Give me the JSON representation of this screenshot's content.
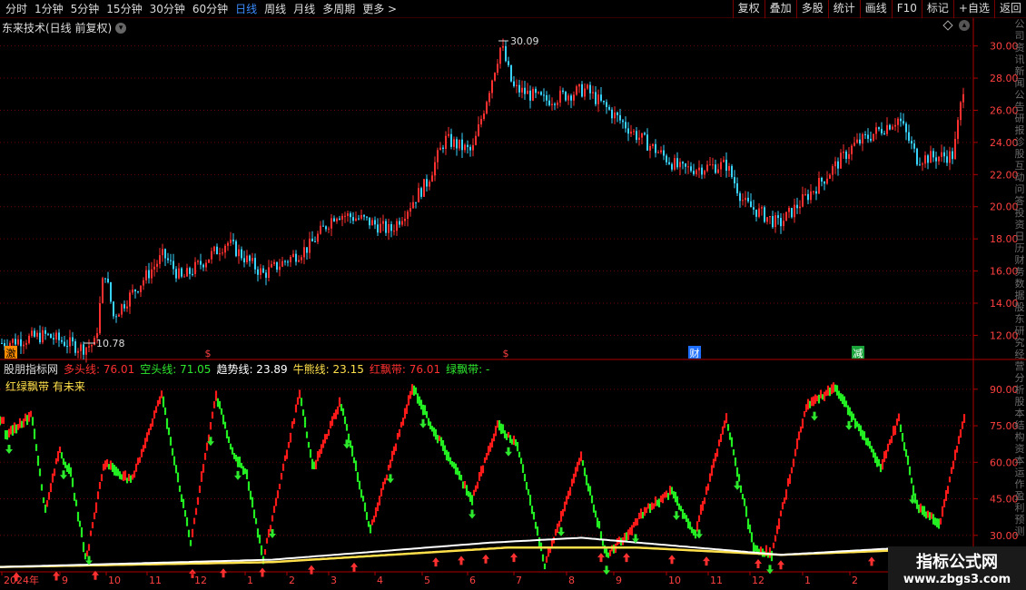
{
  "toolbar": {
    "periods": [
      "分时",
      "1分钟",
      "5分钟",
      "15分钟",
      "30分钟",
      "60分钟",
      "日线",
      "周线",
      "月线",
      "多周期",
      "更多 >"
    ],
    "active_period": "日线",
    "tools": [
      "复权",
      "叠加",
      "多股",
      "统计",
      "画线",
      "F10",
      "标记",
      "+自选",
      "返回"
    ]
  },
  "stock": {
    "title": "东来技术(日线 前复权)"
  },
  "price_chart": {
    "high_label": "30.09",
    "low_label": "10.78",
    "y_ticks": [
      "30.00",
      "28.00",
      "26.00",
      "24.00",
      "22.00",
      "20.00",
      "18.00",
      "16.00",
      "14.00",
      "12.00"
    ],
    "markers": [
      "激",
      "$",
      "$",
      "财",
      "减"
    ]
  },
  "indicator": {
    "name": "股朋指标网",
    "items": [
      {
        "label": "多头线: 76.01",
        "color": "#ff3030"
      },
      {
        "label": "空头线: 71.05",
        "color": "#2ee82e"
      },
      {
        "label": "趋势线: 23.89",
        "color": "#ffffff"
      },
      {
        "label": "牛熊线: 23.15",
        "color": "#ffe04a"
      },
      {
        "label": "红飘带: 76.01",
        "color": "#ff3030"
      },
      {
        "label": "绿飘带: -",
        "color": "#2ee82e"
      }
    ],
    "line2": "红绿飘带 有未来",
    "y_ticks": [
      "90.00",
      "75.00",
      "60.00",
      "45.00",
      "30.00"
    ]
  },
  "x_axis": [
    "2024年",
    "9",
    "10",
    "11",
    "12",
    "1",
    "2",
    "3",
    "4",
    "5",
    "6",
    "7",
    "8",
    "9",
    "10",
    "11",
    "12",
    "1",
    "2"
  ],
  "watermark": {
    "line1": "指标公式网",
    "line2": "www.zbgs3.com"
  },
  "colors": {
    "up": "#ff3030",
    "down": "#39d3ff",
    "ribbon_red": "#ff1a1a",
    "ribbon_green": "#22ee22",
    "trend": "#ffffff",
    "bull": "#ffe04a",
    "grid": "#6a0000"
  },
  "chart_data": {
    "type": "line",
    "ylim": [
      10.5,
      30.6
    ],
    "price_anchors": [
      [
        0,
        11.5
      ],
      [
        50,
        12.0
      ],
      [
        90,
        11.2
      ],
      [
        105,
        11.5
      ],
      [
        115,
        16.2
      ],
      [
        125,
        13.2
      ],
      [
        180,
        17.0
      ],
      [
        200,
        15.5
      ],
      [
        250,
        17.8
      ],
      [
        290,
        15.8
      ],
      [
        340,
        17.5
      ],
      [
        370,
        19.6
      ],
      [
        400,
        19.2
      ],
      [
        430,
        18.5
      ],
      [
        470,
        21.5
      ],
      [
        490,
        24.2
      ],
      [
        520,
        23.4
      ],
      [
        552,
        30.09
      ],
      [
        565,
        27.4
      ],
      [
        600,
        26.6
      ],
      [
        645,
        27.3
      ],
      [
        700,
        24.5
      ],
      [
        750,
        22.3
      ],
      [
        800,
        22.6
      ],
      [
        820,
        20.2
      ],
      [
        858,
        18.9
      ],
      [
        905,
        21.6
      ],
      [
        940,
        23.8
      ],
      [
        990,
        25.5
      ],
      [
        1010,
        23.0
      ],
      [
        1050,
        23.2
      ],
      [
        1063,
        28.2
      ]
    ],
    "indicator_ylim": [
      15,
      100
    ],
    "ribbon_anchors": [
      [
        5,
        70
      ],
      [
        35,
        80
      ],
      [
        50,
        40
      ],
      [
        65,
        65
      ],
      [
        78,
        55
      ],
      [
        95,
        20
      ],
      [
        115,
        60
      ],
      [
        145,
        52
      ],
      [
        178,
        88
      ],
      [
        210,
        27
      ],
      [
        238,
        88
      ],
      [
        255,
        65
      ],
      [
        272,
        55
      ],
      [
        290,
        20
      ],
      [
        330,
        88
      ],
      [
        345,
        57
      ],
      [
        375,
        85
      ],
      [
        408,
        32
      ],
      [
        455,
        91
      ],
      [
        475,
        75
      ],
      [
        520,
        45
      ],
      [
        548,
        75
      ],
      [
        570,
        67
      ],
      [
        600,
        18
      ],
      [
        640,
        62
      ],
      [
        668,
        22
      ],
      [
        690,
        30
      ],
      [
        710,
        40
      ],
      [
        740,
        48
      ],
      [
        765,
        30
      ],
      [
        800,
        78
      ],
      [
        830,
        25
      ],
      [
        850,
        22
      ],
      [
        888,
        83
      ],
      [
        920,
        91
      ],
      [
        945,
        75
      ],
      [
        970,
        58
      ],
      [
        990,
        78
      ],
      [
        1010,
        42
      ],
      [
        1035,
        35
      ],
      [
        1062,
        78
      ]
    ],
    "trend_anchors": [
      [
        0,
        17
      ],
      [
        300,
        20
      ],
      [
        540,
        27
      ],
      [
        640,
        29
      ],
      [
        860,
        22
      ],
      [
        1000,
        25
      ],
      [
        1063,
        25
      ]
    ],
    "bull_anchors": [
      [
        0,
        17
      ],
      [
        300,
        19
      ],
      [
        560,
        25
      ],
      [
        700,
        25
      ],
      [
        860,
        22
      ],
      [
        1000,
        24
      ],
      [
        1063,
        24
      ]
    ]
  }
}
